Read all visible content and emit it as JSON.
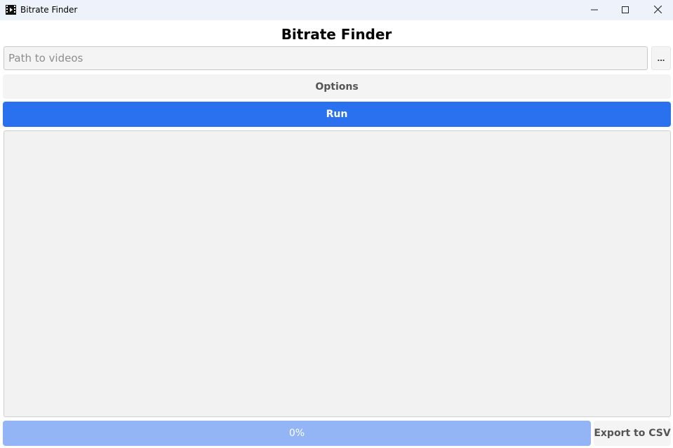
{
  "window": {
    "title": "Bitrate Finder",
    "app_icon": "film-clapper-icon",
    "controls": [
      "minimize-icon",
      "maximize-icon",
      "close-icon"
    ]
  },
  "header": {
    "title": "Bitrate Finder"
  },
  "path": {
    "placeholder": "Path to videos",
    "value": "",
    "browse_label": "..."
  },
  "options": {
    "label": "Options"
  },
  "run": {
    "label": "Run"
  },
  "output": {
    "text": ""
  },
  "progress": {
    "label": "0%",
    "value": 0
  },
  "export": {
    "label": "Export to CSV"
  },
  "colors": {
    "accent": "#2a71f0",
    "progress": "#93b5f5",
    "titlebar": "#eef2fa"
  }
}
